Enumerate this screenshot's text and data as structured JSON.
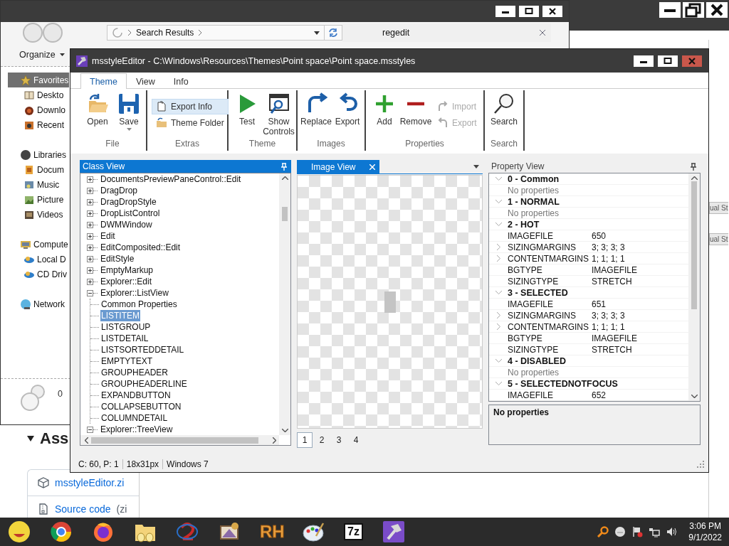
{
  "background_page": {
    "heading": "Ass",
    "assets": [
      {
        "label": "msstyleEditor.zi"
      },
      {
        "label": "Source code",
        "suffix": "(zi"
      }
    ],
    "side_labels": [
      "ual St",
      "ual St"
    ]
  },
  "explorer": {
    "breadcrumb": "Search Results",
    "search_value": "regedit",
    "organize": "Organize",
    "nav": [
      {
        "label": "Favorites",
        "selected": true,
        "children": [
          {
            "label": "Deskto",
            "selected": false
          },
          {
            "label": "Downlo",
            "selected": false
          },
          {
            "label": "Recent",
            "selected": false
          }
        ]
      },
      {
        "label": "Libraries",
        "selected": false,
        "children": [
          {
            "label": "Docum",
            "selected": false
          },
          {
            "label": "Music",
            "selected": false
          },
          {
            "label": "Picture",
            "selected": false
          },
          {
            "label": "Videos",
            "selected": false
          }
        ]
      },
      {
        "label": "Compute",
        "selected": false,
        "children": [
          {
            "label": "Local D",
            "selected": false
          },
          {
            "label": "CD Driv",
            "selected": false
          }
        ]
      },
      {
        "label": "Network",
        "selected": false
      }
    ],
    "details_count": "0"
  },
  "editor": {
    "title": "msstyleEditor - C:\\Windows\\Resources\\Themes\\Point space\\Point space.msstyles",
    "tabs": [
      {
        "label": "Theme",
        "selected": true
      },
      {
        "label": "View",
        "selected": false
      },
      {
        "label": "Info",
        "selected": false
      }
    ],
    "ribbon": [
      {
        "label": "File",
        "items": [
          {
            "kind": "large",
            "label": "Open",
            "dropdown": false
          },
          {
            "kind": "large",
            "label": "Save",
            "dropdown": true
          }
        ]
      },
      {
        "label": "Extras",
        "items": [
          {
            "kind": "small",
            "label": "Export Info",
            "highlighted": true,
            "disabled": false
          },
          {
            "kind": "small",
            "label": "Theme Folder",
            "highlighted": false,
            "disabled": false
          }
        ]
      },
      {
        "label": "Theme",
        "items": [
          {
            "kind": "large",
            "label": "Test",
            "dropdown": false
          },
          {
            "kind": "large",
            "label": "Show Controls",
            "dropdown": false
          }
        ]
      },
      {
        "label": "Images",
        "items": [
          {
            "kind": "large",
            "label": "Replace",
            "dropdown": false
          },
          {
            "kind": "large",
            "label": "Export",
            "dropdown": false
          }
        ]
      },
      {
        "label": "Properties",
        "items": [
          {
            "kind": "large",
            "label": "Add",
            "dropdown": false
          },
          {
            "kind": "large",
            "label": "Remove",
            "dropdown": false
          },
          {
            "kind": "small",
            "label": "Import",
            "highlighted": false,
            "disabled": true
          },
          {
            "kind": "small",
            "label": "Export",
            "highlighted": false,
            "disabled": true
          }
        ]
      },
      {
        "label": "Search",
        "items": [
          {
            "kind": "large",
            "label": "Search",
            "dropdown": false
          }
        ]
      }
    ],
    "class_view": {
      "title": "Class View",
      "items": [
        {
          "label": "DocumentsPreviewPaneControl::Edit",
          "expanded": false,
          "selected": false
        },
        {
          "label": "DragDrop",
          "expanded": false,
          "selected": false
        },
        {
          "label": "DragDropStyle",
          "expanded": false,
          "selected": false
        },
        {
          "label": "DropListControl",
          "expanded": false,
          "selected": false
        },
        {
          "label": "DWMWindow",
          "expanded": false,
          "selected": false
        },
        {
          "label": "Edit",
          "expanded": false,
          "selected": false
        },
        {
          "label": "EditComposited::Edit",
          "expanded": false,
          "selected": false
        },
        {
          "label": "EditStyle",
          "expanded": false,
          "selected": false
        },
        {
          "label": "EmptyMarkup",
          "expanded": false,
          "selected": false
        },
        {
          "label": "Explorer::Edit",
          "expanded": false,
          "selected": false
        },
        {
          "label": "Explorer::ListView",
          "expanded": true,
          "selected": false,
          "children": [
            {
              "label": "Common Properties",
              "selected": false
            },
            {
              "label": "LISTITEM",
              "selected": true
            },
            {
              "label": "LISTGROUP",
              "selected": false
            },
            {
              "label": "LISTDETAIL",
              "selected": false
            },
            {
              "label": "LISTSORTEDDETAIL",
              "selected": false
            },
            {
              "label": "EMPTYTEXT",
              "selected": false
            },
            {
              "label": "GROUPHEADER",
              "selected": false
            },
            {
              "label": "GROUPHEADERLINE",
              "selected": false
            },
            {
              "label": "EXPANDBUTTON",
              "selected": false
            },
            {
              "label": "COLLAPSEBUTTON",
              "selected": false
            },
            {
              "label": "COLUMNDETAIL",
              "selected": false
            }
          ]
        },
        {
          "label": "Explorer::TreeView",
          "expanded": true,
          "selected": false
        }
      ]
    },
    "image_view": {
      "tab": "Image View",
      "pages": [
        {
          "label": "1",
          "selected": true
        },
        {
          "label": "2",
          "selected": false
        },
        {
          "label": "3",
          "selected": false
        },
        {
          "label": "4",
          "selected": false
        }
      ]
    },
    "property_view": {
      "title": "Property View",
      "groups": [
        {
          "title": "0 - Common",
          "expanded": true,
          "note": "No properties"
        },
        {
          "title": "1 - NORMAL",
          "expanded": true,
          "note": "No properties"
        },
        {
          "title": "2 - HOT",
          "expanded": true,
          "rows": [
            {
              "name": "IMAGEFILE",
              "value": "650",
              "expandable": false
            },
            {
              "name": "SIZINGMARGINS",
              "value": "3; 3; 3; 3",
              "expandable": true
            },
            {
              "name": "CONTENTMARGINS",
              "value": "1; 1; 1; 1",
              "expandable": true
            },
            {
              "name": "BGTYPE",
              "value": "IMAGEFILE",
              "expandable": false
            },
            {
              "name": "SIZINGTYPE",
              "value": "STRETCH",
              "expandable": false
            }
          ]
        },
        {
          "title": "3 - SELECTED",
          "expanded": true,
          "rows": [
            {
              "name": "IMAGEFILE",
              "value": "651",
              "expandable": false
            },
            {
              "name": "SIZINGMARGINS",
              "value": "3; 3; 3; 3",
              "expandable": true
            },
            {
              "name": "CONTENTMARGINS",
              "value": "1; 1; 1; 1",
              "expandable": true
            },
            {
              "name": "BGTYPE",
              "value": "IMAGEFILE",
              "expandable": false
            },
            {
              "name": "SIZINGTYPE",
              "value": "STRETCH",
              "expandable": false
            }
          ]
        },
        {
          "title": "4 - DISABLED",
          "expanded": true,
          "note": "No properties"
        },
        {
          "title": "5 - SELECTEDNOTFOCUS",
          "expanded": true,
          "rows": [
            {
              "name": "IMAGEFILE",
              "value": "652",
              "expandable": false
            }
          ]
        }
      ],
      "description": "No properties"
    },
    "status_bar": [
      "C: 60, P: 1",
      "18x31px",
      "Windows 7"
    ]
  },
  "taskbar": {
    "apps": [
      {
        "kind": "smiley"
      },
      {
        "kind": "ring"
      },
      {
        "kind": "flame"
      },
      {
        "kind": "folder"
      },
      {
        "kind": "swirl"
      },
      {
        "kind": "easel"
      },
      {
        "kind": "text",
        "label": "RH"
      },
      {
        "kind": "palette"
      },
      {
        "kind": "box",
        "label": "7z"
      },
      {
        "kind": "hammer"
      }
    ],
    "clock_time": "3:06 PM",
    "clock_date": "9/1/2022"
  }
}
